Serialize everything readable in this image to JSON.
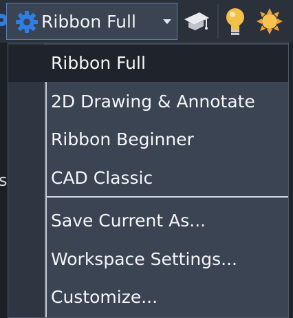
{
  "toolbar": {
    "workspace_label": "Ribbon Full",
    "icons": [
      "gear-icon",
      "graduation-cap-icon",
      "lightbulb-icon",
      "sun-icon",
      "chevron-down-icon"
    ]
  },
  "background_text": "s",
  "menu": {
    "items": [
      {
        "label": "Ribbon Full",
        "current": true
      },
      {
        "label": "2D Drawing & Annotate"
      },
      {
        "label": "Ribbon Beginner"
      },
      {
        "label": "CAD Classic"
      },
      {
        "label": "Save Current As..."
      },
      {
        "label": "Workspace Settings..."
      },
      {
        "label": "Customize..."
      }
    ]
  },
  "colors": {
    "menu_bg": "#3b4453",
    "highlight_bg": "#1f242c",
    "text": "#f4f6f8",
    "dropdown_border": "#5d80b3",
    "gear_blue": "#2f7ee6"
  }
}
